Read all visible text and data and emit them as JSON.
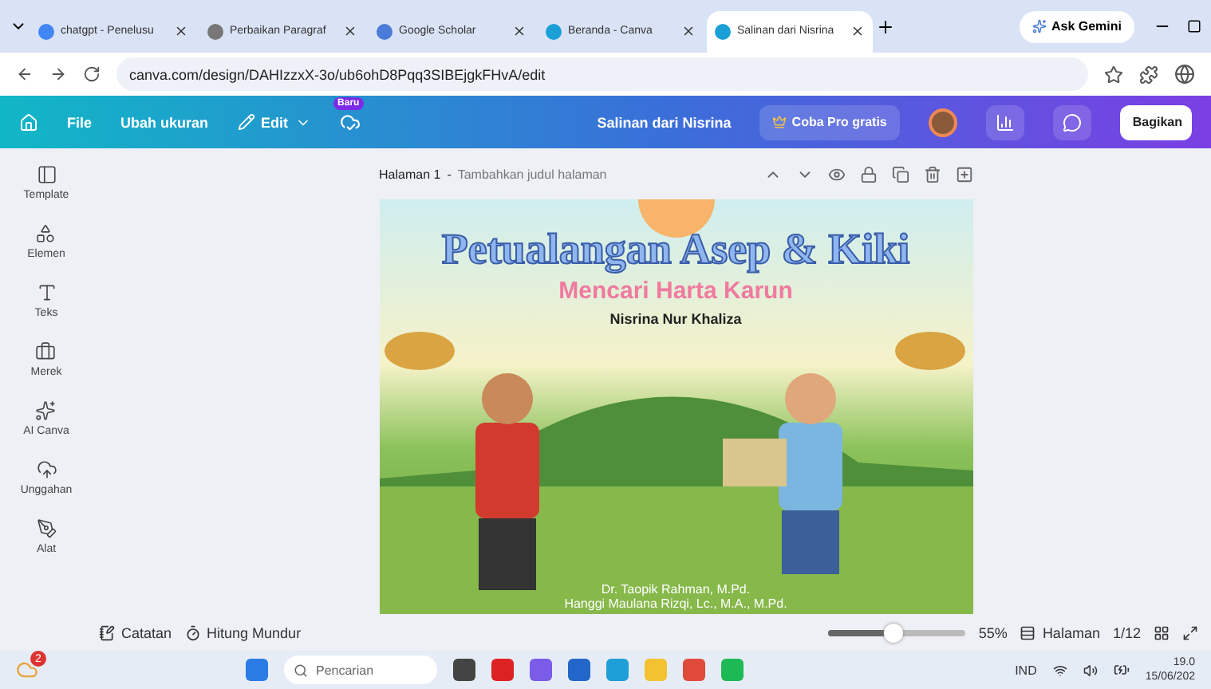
{
  "browser": {
    "tabs": [
      {
        "title": "chatgpt - Penelusu",
        "selected": false
      },
      {
        "title": "Perbaikan Paragraf",
        "selected": false
      },
      {
        "title": "Google Scholar",
        "selected": false
      },
      {
        "title": "Beranda - Canva",
        "selected": false
      },
      {
        "title": "Salinan dari Nisrina",
        "selected": true
      }
    ],
    "ask_button": "Ask Gemini",
    "url": "canva.com/design/DAHIzzxX-3o/ub6ohD8Pqq3SIBEjgkFHvA/edit"
  },
  "topbar": {
    "menu": [
      "File",
      "Ubah ukuran"
    ],
    "edit": "Edit",
    "new_badge": "Baru",
    "doc_title": "Salinan dari Nisrina",
    "pro_button": "Coba Pro gratis",
    "share_button": "Bagikan"
  },
  "sidebar": {
    "items": [
      {
        "label": "Template",
        "kind": "template"
      },
      {
        "label": "Elemen",
        "kind": "elements"
      },
      {
        "label": "Teks",
        "kind": "text"
      },
      {
        "label": "Merek",
        "kind": "brand"
      },
      {
        "label": "AI Canva",
        "kind": "ai"
      },
      {
        "label": "Unggahan",
        "kind": "upload"
      },
      {
        "label": "Alat",
        "kind": "tools"
      }
    ]
  },
  "page": {
    "label": "Halaman 1",
    "separator": "-",
    "title_placeholder": "Tambahkan judul halaman",
    "cover": {
      "title": "Petualangan Asep & Kiki",
      "subtitle": "Mencari Harta Karun",
      "author": "Nisrina Nur Khaliza",
      "credits": [
        "Dr. Taopik Rahman, M.Pd.",
        "Hanggi Maulana Rizqi, Lc., M.A., M.Pd."
      ]
    }
  },
  "footer": {
    "notes": "Catatan",
    "timer": "Hitung Mundur",
    "zoom": {
      "level": 0.47,
      "reading": "55%"
    },
    "pages_button": "Halaman",
    "page_count": "1/12"
  },
  "taskbar": {
    "weather_badge": "2",
    "search_placeholder": "Pencarian",
    "language": "IND",
    "time": "19.0",
    "date": "15/06/202"
  }
}
